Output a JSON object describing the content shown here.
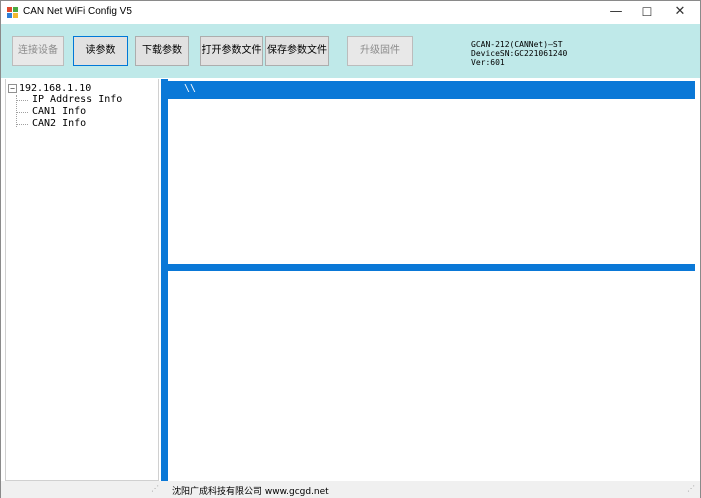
{
  "window": {
    "title": "CAN Net WiFi Config V5",
    "controls": {
      "minimize": "—",
      "maximize": "☐",
      "close": "✕"
    }
  },
  "toolbar": {
    "buttons": [
      {
        "label": "连接设备",
        "enabled": false
      },
      {
        "label": "读参数",
        "enabled": true
      },
      {
        "label": "下载参数",
        "enabled": true
      },
      {
        "label": "打开参数文件",
        "enabled": true
      },
      {
        "label": "保存参数文件",
        "enabled": true
      },
      {
        "label": "升级固件",
        "enabled": false
      }
    ],
    "device_info": {
      "model": "GCAN-212(CANNet)—ST",
      "serial": "DeviceSN:GC221061240",
      "version": "Ver:601"
    }
  },
  "tree": {
    "root": {
      "expander": "−",
      "label": "192.168.1.10"
    },
    "children": [
      "IP Address Info",
      "CAN1 Info",
      "CAN2 Info"
    ]
  },
  "upper_panel": {
    "selected_row_text": "\\\\"
  },
  "statusbar": {
    "company": "沈阳广成科技有限公司   www.gcgd.net"
  },
  "colors": {
    "toolbar_bg": "#bfe9e9",
    "accent": "#0a78d7"
  }
}
